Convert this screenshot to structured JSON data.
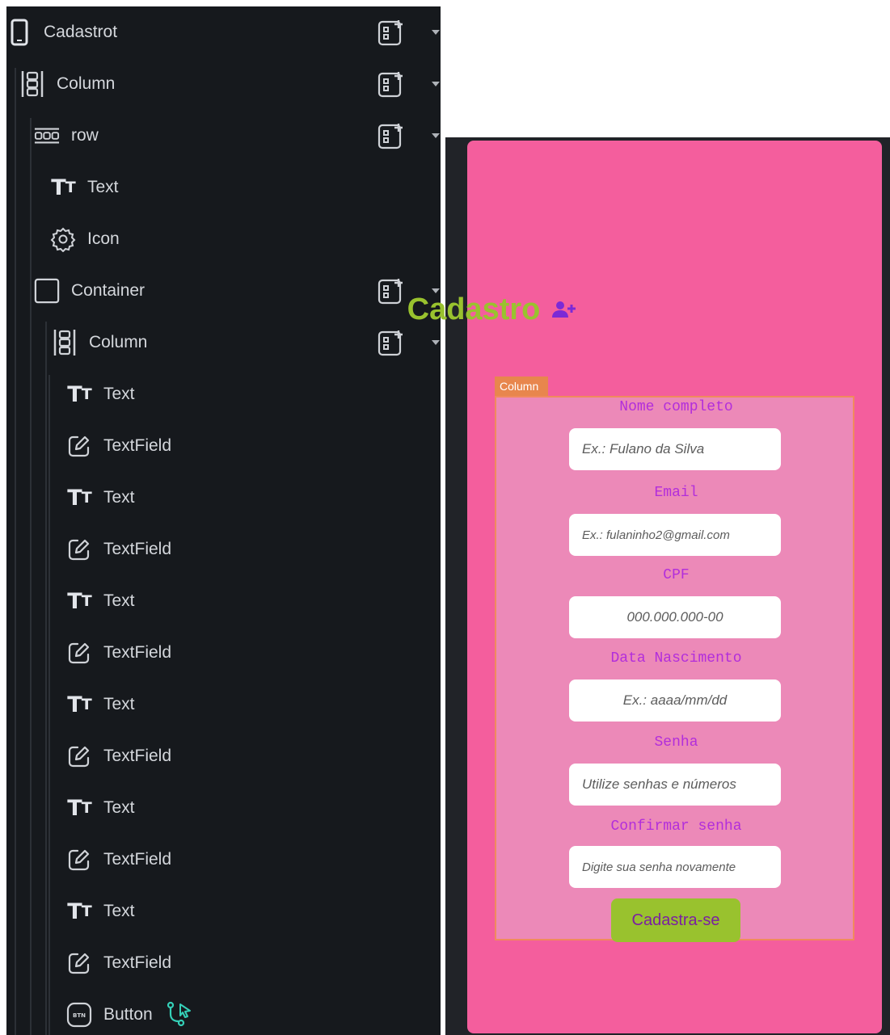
{
  "tree": {
    "nodes": [
      {
        "label": "Cadastrot",
        "icon": "phone-icon",
        "can_add": true
      },
      {
        "label": "Column",
        "icon": "column-icon",
        "can_add": true
      },
      {
        "label": "row",
        "icon": "row-icon",
        "can_add": true
      },
      {
        "label": "Text",
        "icon": "text-icon",
        "can_add": false
      },
      {
        "label": "Icon",
        "icon": "gear-icon",
        "can_add": false
      },
      {
        "label": "Container",
        "icon": "container-icon",
        "can_add": true
      },
      {
        "label": "Column",
        "icon": "column-icon",
        "can_add": true
      },
      {
        "label": "Text",
        "icon": "text-icon",
        "can_add": false
      },
      {
        "label": "TextField",
        "icon": "textfield-icon",
        "can_add": false
      },
      {
        "label": "Text",
        "icon": "text-icon",
        "can_add": false
      },
      {
        "label": "TextField",
        "icon": "textfield-icon",
        "can_add": false
      },
      {
        "label": "Text",
        "icon": "text-icon",
        "can_add": false
      },
      {
        "label": "TextField",
        "icon": "textfield-icon",
        "can_add": false
      },
      {
        "label": "Text",
        "icon": "text-icon",
        "can_add": false
      },
      {
        "label": "TextField",
        "icon": "textfield-icon",
        "can_add": false
      },
      {
        "label": "Text",
        "icon": "text-icon",
        "can_add": false
      },
      {
        "label": "TextField",
        "icon": "textfield-icon",
        "can_add": false
      },
      {
        "label": "Text",
        "icon": "text-icon",
        "can_add": false
      },
      {
        "label": "TextField",
        "icon": "textfield-icon",
        "can_add": false
      },
      {
        "label": "Button",
        "icon": "button-icon",
        "can_add": false,
        "badge_icon": "action-flow-icon"
      }
    ],
    "icon_glyphs": {
      "text-big": "T",
      "text-small": "T",
      "button-text": "BTN"
    }
  },
  "preview": {
    "title": "Cadastro",
    "title_icon": "person-add-icon",
    "column_tag": "Column",
    "fields": [
      {
        "label": "Nome completo",
        "placeholder": "Ex.: Fulano da Silva",
        "align": "left"
      },
      {
        "label": "Email",
        "placeholder": "Ex.: fulaninho2@gmail.com",
        "align": "left"
      },
      {
        "label": "CPF",
        "placeholder": "000.000.000-00",
        "align": "center"
      },
      {
        "label": "Data Nascimento",
        "placeholder": "Ex.: aaaa/mm/dd",
        "align": "center"
      },
      {
        "label": "Senha",
        "placeholder": "Utilize senhas e números",
        "align": "left"
      },
      {
        "label": "Confirmar senha",
        "placeholder": "Digite sua senha novamente",
        "align": "left"
      }
    ],
    "submit_label": "Cadastra-se"
  },
  "colors": {
    "panel_bg": "#16191d",
    "phone_bg": "#f45e9d",
    "column_bg": "#ec89b8",
    "accent_green": "#99c22e",
    "label_purple": "#b22edb",
    "button_text": "#7b1fa2",
    "selection_orange": "#e8864d",
    "flow_teal": "#35d0b8"
  }
}
